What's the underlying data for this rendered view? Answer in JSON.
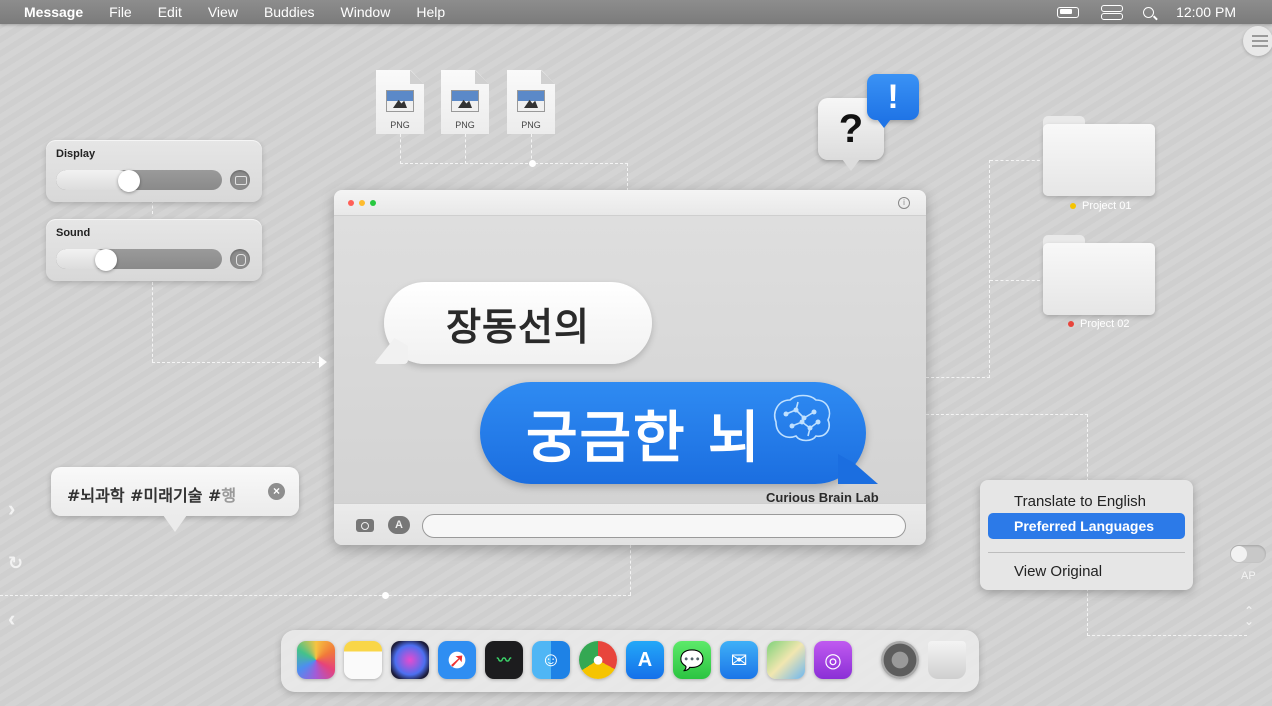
{
  "menubar": {
    "app_name": "Message",
    "items": [
      "File",
      "Edit",
      "View",
      "Buddies",
      "Window",
      "Help"
    ],
    "clock": "12:00 PM",
    "status_icons": [
      "battery-icon",
      "control-center-icon",
      "search-icon"
    ]
  },
  "controls": {
    "display": {
      "label": "Display",
      "level": 0.44,
      "icon": "display-icon"
    },
    "sound": {
      "label": "Sound",
      "level": 0.3,
      "icon": "speaker-icon"
    }
  },
  "files": [
    {
      "ext": "PNG"
    },
    {
      "ext": "PNG"
    },
    {
      "ext": "PNG"
    }
  ],
  "alert": {
    "question": "?",
    "exclaim": "!"
  },
  "window": {
    "bubble_gray": "장동선의",
    "bubble_blue": "궁금한 뇌",
    "lab_name": "Curious Brain Lab",
    "traffic_lights": [
      "#ff5f57",
      "#febc2e",
      "#28c840"
    ],
    "message_placeholder": ""
  },
  "folders": [
    {
      "label": "Project 01",
      "tag_color": "#f5c400"
    },
    {
      "label": "Project 02",
      "tag_color": "#e8453c"
    }
  ],
  "hashtags": {
    "text": "#뇌과학 #미래기술 #",
    "overflow": "행"
  },
  "context_menu": {
    "items": [
      "Translate to English",
      "Preferred Languages",
      "View Original"
    ],
    "highlighted": "Preferred Languages",
    "highlight_color": "#2c7ae8"
  },
  "right_controls": {
    "toggle_label": "AP"
  },
  "dock": {
    "apps": [
      "photos-icon",
      "notes-icon",
      "siri-icon",
      "safari-icon",
      "stocks-icon",
      "finder-icon",
      "chrome-icon",
      "app-store-icon",
      "messages-icon",
      "mail-icon",
      "maps-icon",
      "podcasts-icon",
      "system-preferences-icon",
      "trash-icon"
    ]
  }
}
